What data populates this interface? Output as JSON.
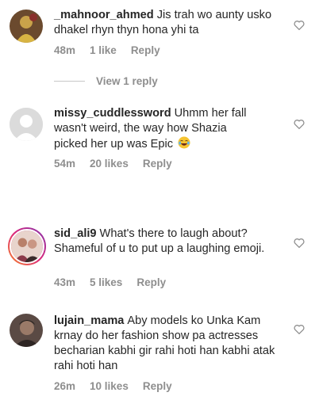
{
  "comments": [
    {
      "username": "_mahnoor_ahmed",
      "text": "Jis trah wo aunty usko dhakel rhyn thyn hona yhi ta",
      "time": "48m",
      "likes": "1 like",
      "reply": "Reply",
      "view_replies": "View 1 reply",
      "avatar_icon": "profile-photo",
      "heart_icon": "heart-outline-icon"
    },
    {
      "username": "missy_cuddlessword",
      "text": "Uhmm her fall wasn't weird, the way how Shazia picked her up was Epic",
      "emoji": "😂",
      "time": "54m",
      "likes": "20 likes",
      "reply": "Reply",
      "avatar_icon": "default-avatar-icon",
      "heart_icon": "heart-outline-icon"
    },
    {
      "username": "sid_ali9",
      "text": "What's there to laugh about? Shameful of u to put up a laughing emoji.",
      "time": "43m",
      "likes": "5 likes",
      "reply": "Reply",
      "avatar_icon": "profile-photo-story-ring",
      "heart_icon": "heart-outline-icon"
    },
    {
      "username": "lujain_mama",
      "text": "Aby models ko Unka Kam krnay do her fashion show pa actresses becharian kabhi gir rahi hoti han kabhi atak rahi hoti han",
      "time": "26m",
      "likes": "10 likes",
      "reply": "Reply",
      "avatar_icon": "profile-photo",
      "heart_icon": "heart-outline-icon"
    }
  ]
}
